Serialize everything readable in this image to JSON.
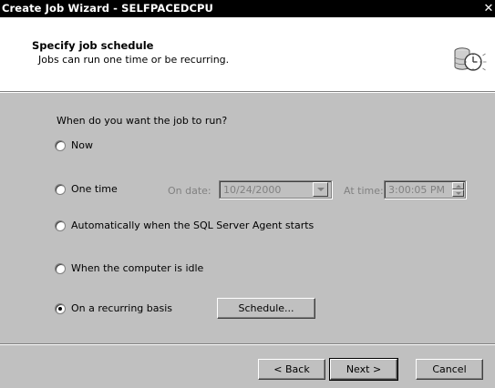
{
  "window": {
    "title": "Create Job Wizard - SELFPACEDCPU",
    "close_glyph": "✕"
  },
  "header": {
    "title": "Specify job schedule",
    "subtitle": "Jobs can run one time or be recurring.",
    "icon": "schedule-clock-database-icon"
  },
  "main": {
    "question": "When do you want the job to run?",
    "options": [
      {
        "label": "Now",
        "checked": false
      },
      {
        "label": "One time",
        "checked": false
      },
      {
        "label": "Automatically when the SQL Server Agent starts",
        "checked": false
      },
      {
        "label": "When the computer is idle",
        "checked": false
      },
      {
        "label": "On a recurring basis",
        "checked": true
      }
    ],
    "one_time": {
      "date_label": "On date:",
      "date_value": "10/24/2000",
      "time_label": "At time:",
      "time_value": "3:00:05 PM"
    },
    "schedule_button": "Schedule..."
  },
  "footer": {
    "back": "< Back",
    "next": "Next >",
    "cancel": "Cancel"
  },
  "colors": {
    "titlebar": "#000000",
    "dialog": "#c0c0c0",
    "header": "#ffffff",
    "disabled_text": "#808080"
  }
}
